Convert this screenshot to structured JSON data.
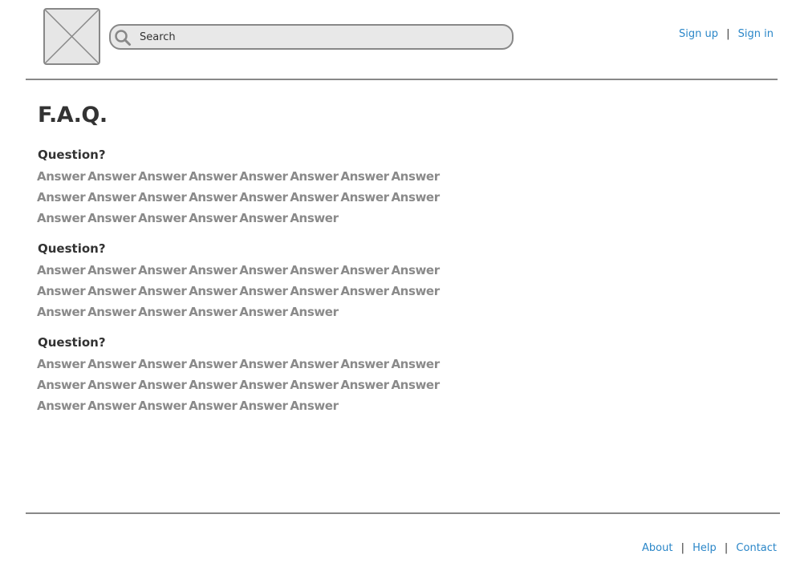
{
  "header": {
    "logo_icon": "image-placeholder-icon",
    "search": {
      "icon": "search-icon",
      "placeholder": "Search",
      "value": ""
    },
    "auth": {
      "sign_up": "Sign up",
      "separator": "|",
      "sign_in": "Sign in"
    }
  },
  "main": {
    "title": "F.A.Q.",
    "faqs": [
      {
        "question": "Question?",
        "answer": "Answer Answer Answer Answer Answer Answer Answer Answer Answer Answer Answer Answer Answer Answer Answer Answer Answer Answer Answer Answer Answer Answer"
      },
      {
        "question": "Question?",
        "answer": "Answer Answer Answer Answer Answer Answer Answer Answer Answer Answer Answer Answer Answer Answer Answer Answer Answer Answer Answer Answer Answer Answer"
      },
      {
        "question": "Question?",
        "answer": "Answer Answer Answer Answer Answer Answer Answer Answer Answer Answer Answer Answer Answer Answer Answer Answer Answer Answer Answer Answer Answer Answer"
      }
    ]
  },
  "footer": {
    "links": {
      "about": "About",
      "sep1": "|",
      "help": "Help",
      "sep2": "|",
      "contact": "Contact"
    }
  },
  "colors": {
    "link": "#2a86c8",
    "text": "#333333",
    "answer_text": "#8a8a8a",
    "rule": "#888888",
    "search_bg": "#e8e8e8"
  }
}
